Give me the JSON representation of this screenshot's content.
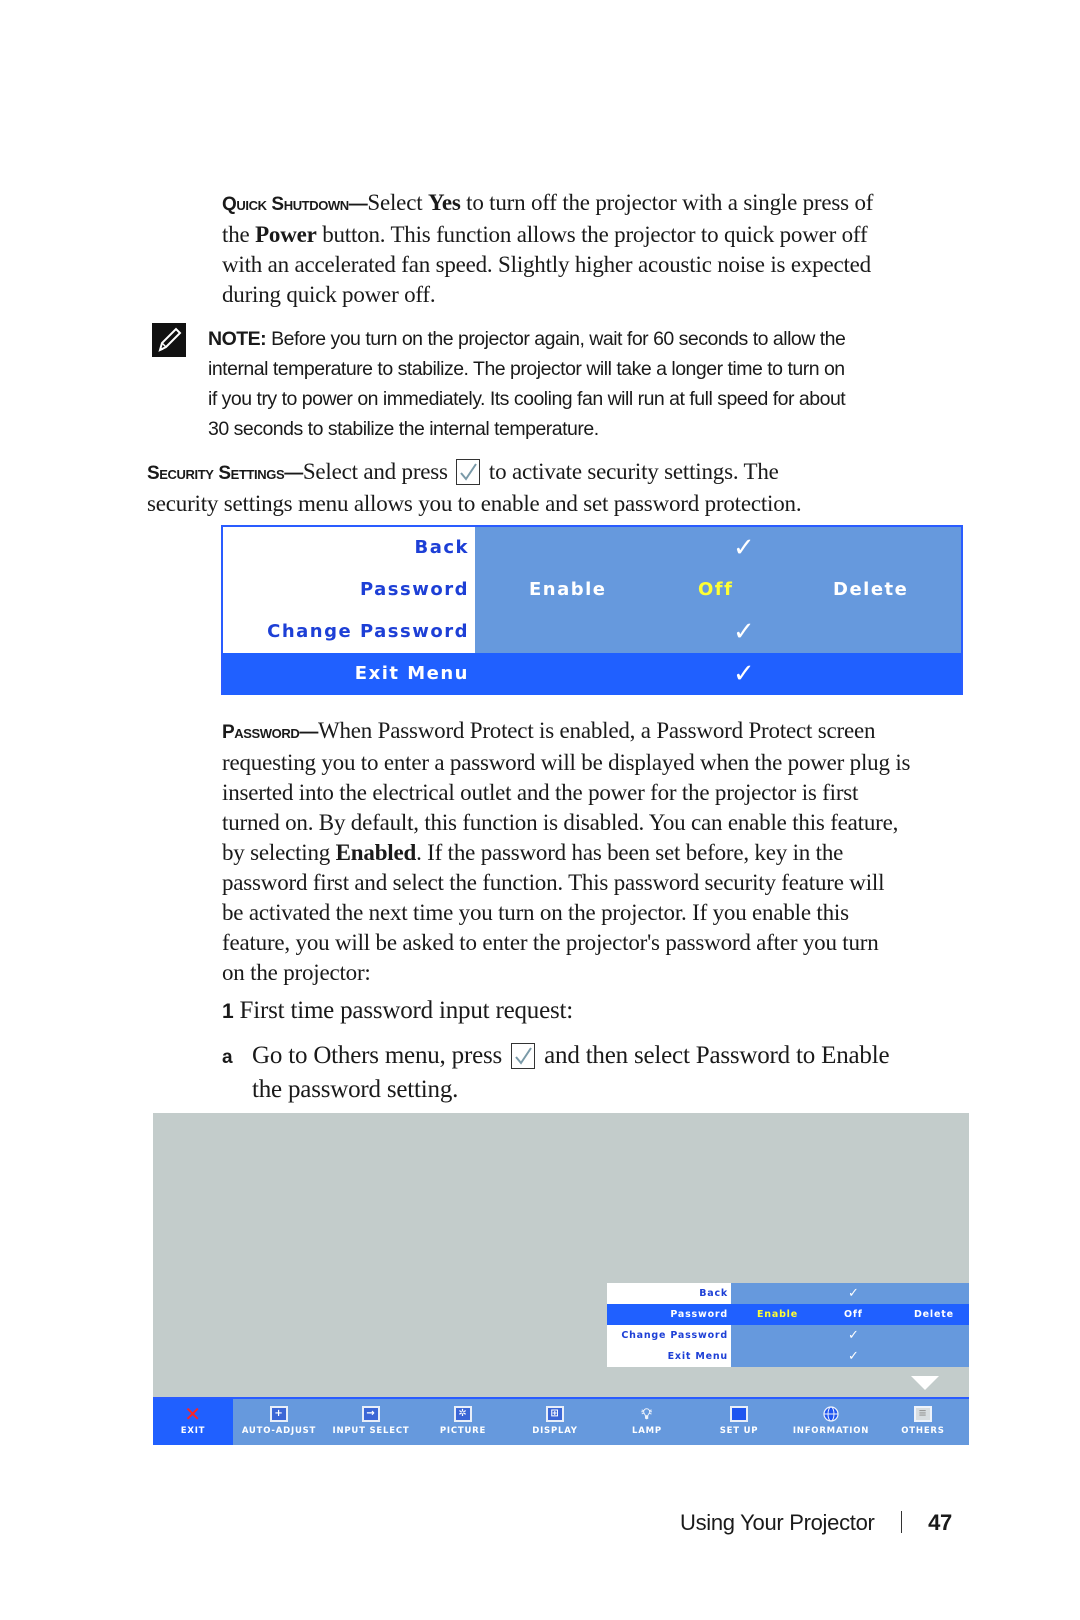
{
  "quick_shutdown": {
    "lead": "Quick Shutdown—",
    "t1": "Select ",
    "b1": "Yes",
    "t2": " to turn off the projector with a single press of",
    "line2a": "the ",
    "b2": "Power",
    "line2b": " button. This function allows the projector to quick power off",
    "line3": "with an accelerated fan speed. Slightly higher acoustic noise is expected",
    "line4": "during quick power off."
  },
  "note": {
    "icon": "note-pencil-icon",
    "label": "NOTE:",
    "line1": " Before you turn on the projector again, wait for 60 seconds to allow the",
    "line2": "internal temperature to stabilize. The projector will take a longer time to turn on",
    "line3": "if you try to power on immediately. Its cooling fan will run at full speed for about",
    "line4": "30 seconds to stabilize the internal temperature."
  },
  "security_settings": {
    "lead": "Security Settings—",
    "t1": "Select and press ",
    "press_icon": "checkmark-button-icon",
    "t2": " to activate security settings. The",
    "line2": "security settings menu allows you to enable and set password protection."
  },
  "osd_menu_1": {
    "rows": [
      {
        "label": "Back",
        "value": "check"
      },
      {
        "label": "Password",
        "options": [
          "Enable",
          "Off",
          "Delete"
        ],
        "selected_option": "Off"
      },
      {
        "label": "Change Password",
        "value": "check"
      },
      {
        "label": "Exit Menu",
        "value": "check",
        "highlighted": true
      }
    ],
    "colors": {
      "label_text": "#1d3fd6",
      "value_bg": "#6699dd",
      "highlight_bg": "#2060ff",
      "selected_option": "#ffff33"
    }
  },
  "password": {
    "lead": "Password—",
    "line1": "When Password Protect is enabled, a Password Protect screen",
    "line2": "requesting you to enter a password will be displayed when the power plug is",
    "line3": "inserted into the electrical outlet and the power for the projector is first",
    "line4": "turned on. By default, this function is disabled. You can enable this feature,",
    "line5a": "by selecting ",
    "b5": "Enabled",
    "line5b": ". If the password has been set before, key in the",
    "line6": "password first and select the function. This password security feature will",
    "line7": "be activated the next time you turn on the projector. If you enable this",
    "line8": "feature, you will be asked to enter the projector's password after you turn",
    "line9": "on the projector:"
  },
  "step1": {
    "num": "1",
    "text": "First time password input request:"
  },
  "step_a": {
    "letter": "a",
    "t1": "Go to ",
    "b1": "Others",
    "t2": " menu, press ",
    "t3": " and then select ",
    "b2": "Password",
    "t4": " to ",
    "b3": "Enable",
    "line2": "the password setting."
  },
  "osd_menu_2": {
    "rows": [
      {
        "label": "Back",
        "value": "check"
      },
      {
        "label": "Password",
        "options": [
          "Enable",
          "Off",
          "Delete"
        ],
        "selected_option": "Enable",
        "highlighted": true
      },
      {
        "label": "Change Password",
        "value": "check"
      },
      {
        "label": "Exit Menu",
        "value": "check"
      }
    ],
    "screen_bg": "#c3cccb"
  },
  "toolbar": {
    "items": [
      {
        "label": "EXIT",
        "icon": "exit-x-icon",
        "active": true
      },
      {
        "label": "AUTO-ADJUST",
        "icon": "auto-adjust-icon"
      },
      {
        "label": "INPUT SELECT",
        "icon": "input-select-icon"
      },
      {
        "label": "PICTURE",
        "icon": "picture-icon"
      },
      {
        "label": "DISPLAY",
        "icon": "display-icon"
      },
      {
        "label": "LAMP",
        "icon": "lamp-icon"
      },
      {
        "label": "SET UP",
        "icon": "setup-icon"
      },
      {
        "label": "INFORMATION",
        "icon": "information-globe-icon"
      },
      {
        "label": "OTHERS",
        "icon": "others-icon"
      }
    ]
  },
  "footer": {
    "section": "Using Your Projector",
    "page": "47"
  }
}
